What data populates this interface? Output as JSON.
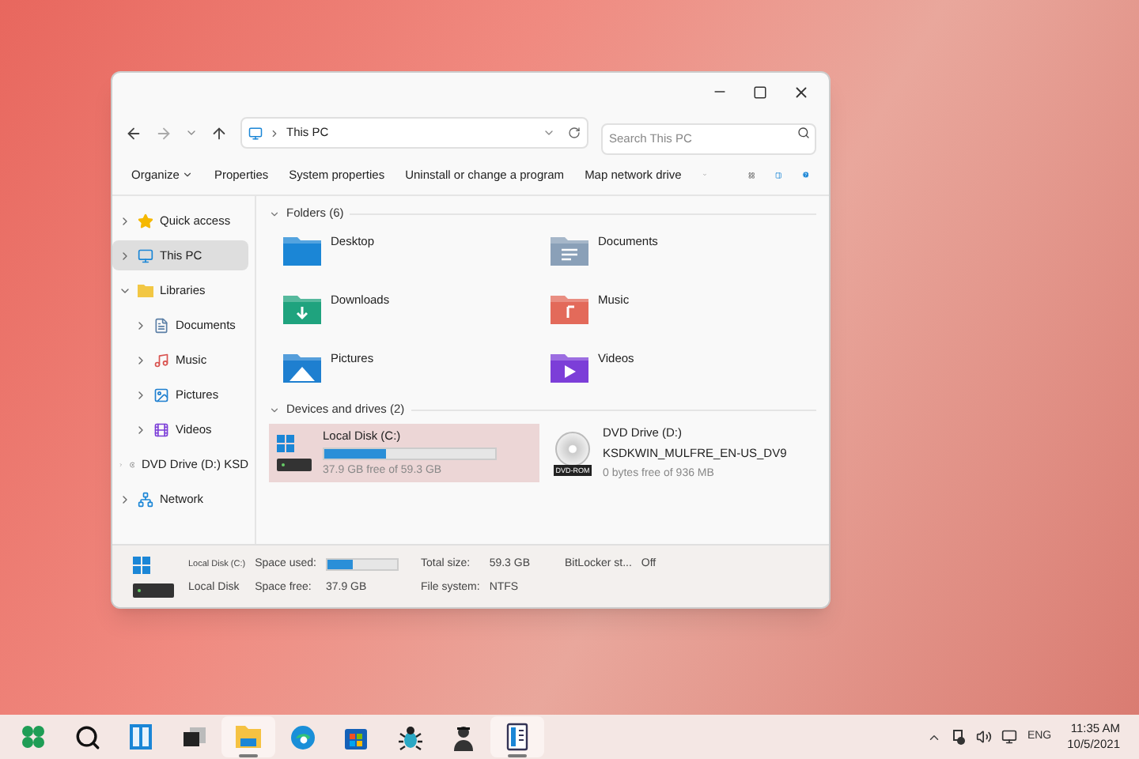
{
  "address": {
    "path": "This PC",
    "search_placeholder": "Search This PC"
  },
  "commands": [
    {
      "label": "Organize",
      "dropdown": true
    },
    {
      "label": "Properties",
      "dropdown": false
    },
    {
      "label": "System properties",
      "dropdown": false
    },
    {
      "label": "Uninstall or change a program",
      "dropdown": false
    },
    {
      "label": "Map network drive",
      "dropdown": false
    }
  ],
  "sidebar": [
    {
      "label": "Quick access",
      "kind": "star",
      "expanded": false,
      "selected": false
    },
    {
      "label": "This PC",
      "kind": "pc",
      "expanded": false,
      "selected": true
    },
    {
      "label": "Libraries",
      "kind": "folder",
      "expanded": true,
      "selected": false,
      "children": [
        {
          "label": "Documents",
          "kind": "documents",
          "expanded": false,
          "selected": false
        },
        {
          "label": "Music",
          "kind": "music",
          "expanded": false,
          "selected": false
        },
        {
          "label": "Pictures",
          "kind": "pictures",
          "expanded": false,
          "selected": false
        },
        {
          "label": "Videos",
          "kind": "videos",
          "expanded": false,
          "selected": false
        }
      ]
    },
    {
      "label": "DVD Drive (D:) KSD",
      "kind": "dvd",
      "expanded": false,
      "selected": false
    },
    {
      "label": "Network",
      "kind": "network",
      "expanded": false,
      "selected": false
    }
  ],
  "folders": {
    "title": "Folders (6)",
    "items": [
      {
        "label": "Desktop",
        "kind": "desktop"
      },
      {
        "label": "Documents",
        "kind": "documents"
      },
      {
        "label": "Downloads",
        "kind": "downloads"
      },
      {
        "label": "Music",
        "kind": "music"
      },
      {
        "label": "Pictures",
        "kind": "pictures"
      },
      {
        "label": "Videos",
        "kind": "videos"
      }
    ]
  },
  "drives": {
    "title": "Devices and drives (2)",
    "items": [
      {
        "kind": "disk",
        "label": "Local Disk (C:)",
        "selected": true,
        "level": 0.36,
        "free": "37.9 GB free of 59.3 GB"
      },
      {
        "kind": "dvd",
        "label": "DVD Drive (D:)",
        "subtitle": "KSDKWIN_MULFRE_EN-US_DV9",
        "badge": "DVD-ROM",
        "selected": false,
        "free": "0 bytes free of 936 MB"
      }
    ]
  },
  "details": {
    "name": "Local Disk (C:)",
    "type": "Local Disk",
    "space_used_label": "Space used:",
    "level": 0.36,
    "space_free_label": "Space free:",
    "space_free": "37.9 GB",
    "total_label": "Total size:",
    "total": "59.3 GB",
    "fs_label": "File system:",
    "fs": "NTFS",
    "bitlocker_label": "BitLocker st...",
    "bitlocker": "Off"
  },
  "taskbar": [
    {
      "kind": "start",
      "running": false
    },
    {
      "kind": "search",
      "running": false
    },
    {
      "kind": "widgets",
      "running": false
    },
    {
      "kind": "taskview",
      "running": false
    },
    {
      "kind": "explorer",
      "running": true
    },
    {
      "kind": "edge",
      "running": false
    },
    {
      "kind": "store",
      "running": false
    },
    {
      "kind": "bug",
      "running": false
    },
    {
      "kind": "agent",
      "running": false
    },
    {
      "kind": "app",
      "running": true
    }
  ],
  "tray": {
    "language": "ENG",
    "time": "11:35 AM",
    "date": "10/5/2021"
  }
}
